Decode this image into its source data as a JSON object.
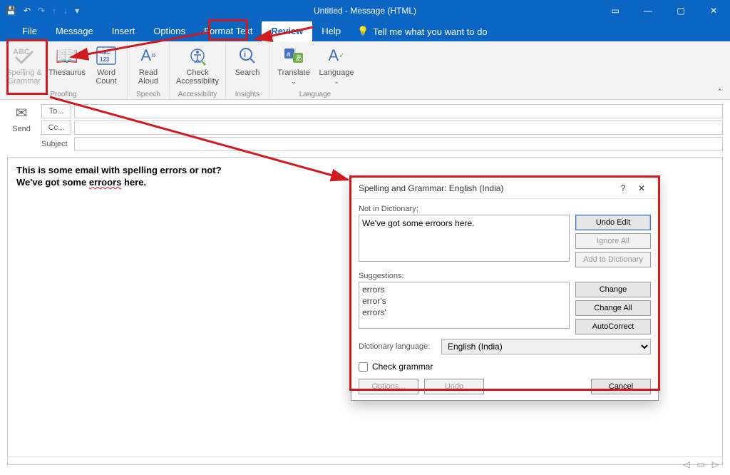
{
  "title": "Untitled  -  Message (HTML)",
  "menu": {
    "file": "File",
    "message": "Message",
    "insert": "Insert",
    "options": "Options",
    "format": "Format Text",
    "review": "Review",
    "help": "Help",
    "tellme": "Tell me what you want to do"
  },
  "ribbon": {
    "spelling": "Spelling &\nGrammar",
    "thesaurus": "Thesaurus",
    "wordcount": "Word\nCount",
    "g_proofing": "Proofing",
    "readaloud": "Read\nAloud",
    "g_speech": "Speech",
    "access": "Check\nAccessibility",
    "g_access": "Accessibility",
    "search": "Search",
    "g_insights": "Insights",
    "translate": "Translate",
    "language": "Language",
    "g_lang": "Language"
  },
  "compose": {
    "send": "Send",
    "to": "To...",
    "cc": "Cc...",
    "subject": "Subject"
  },
  "body": {
    "line1": "This is some email with spelling errors or not?",
    "line2a": "We've got some ",
    "line2err": "erroors",
    "line2b": " here."
  },
  "dialog": {
    "title": "Spelling and Grammar: English (India)",
    "notindict": "Not in Dictionary;",
    "sentence": "We've got some erroors here.",
    "undoedit": "Undo Edit",
    "ignoreall": "Ignore All",
    "addtodict": "Add to Dictionary",
    "suggestions_lbl": "Suggestions:",
    "suggestions": [
      "errors",
      "error's",
      "errors'"
    ],
    "change": "Change",
    "changeall": "Change All",
    "autocorrect": "AutoCorrect",
    "dictlang_lbl": "Dictionary language:",
    "dictlang": "English (India)",
    "checkgrammar": "Check grammar",
    "options": "Options...",
    "undo": "Undo",
    "cancel": "Cancel"
  }
}
